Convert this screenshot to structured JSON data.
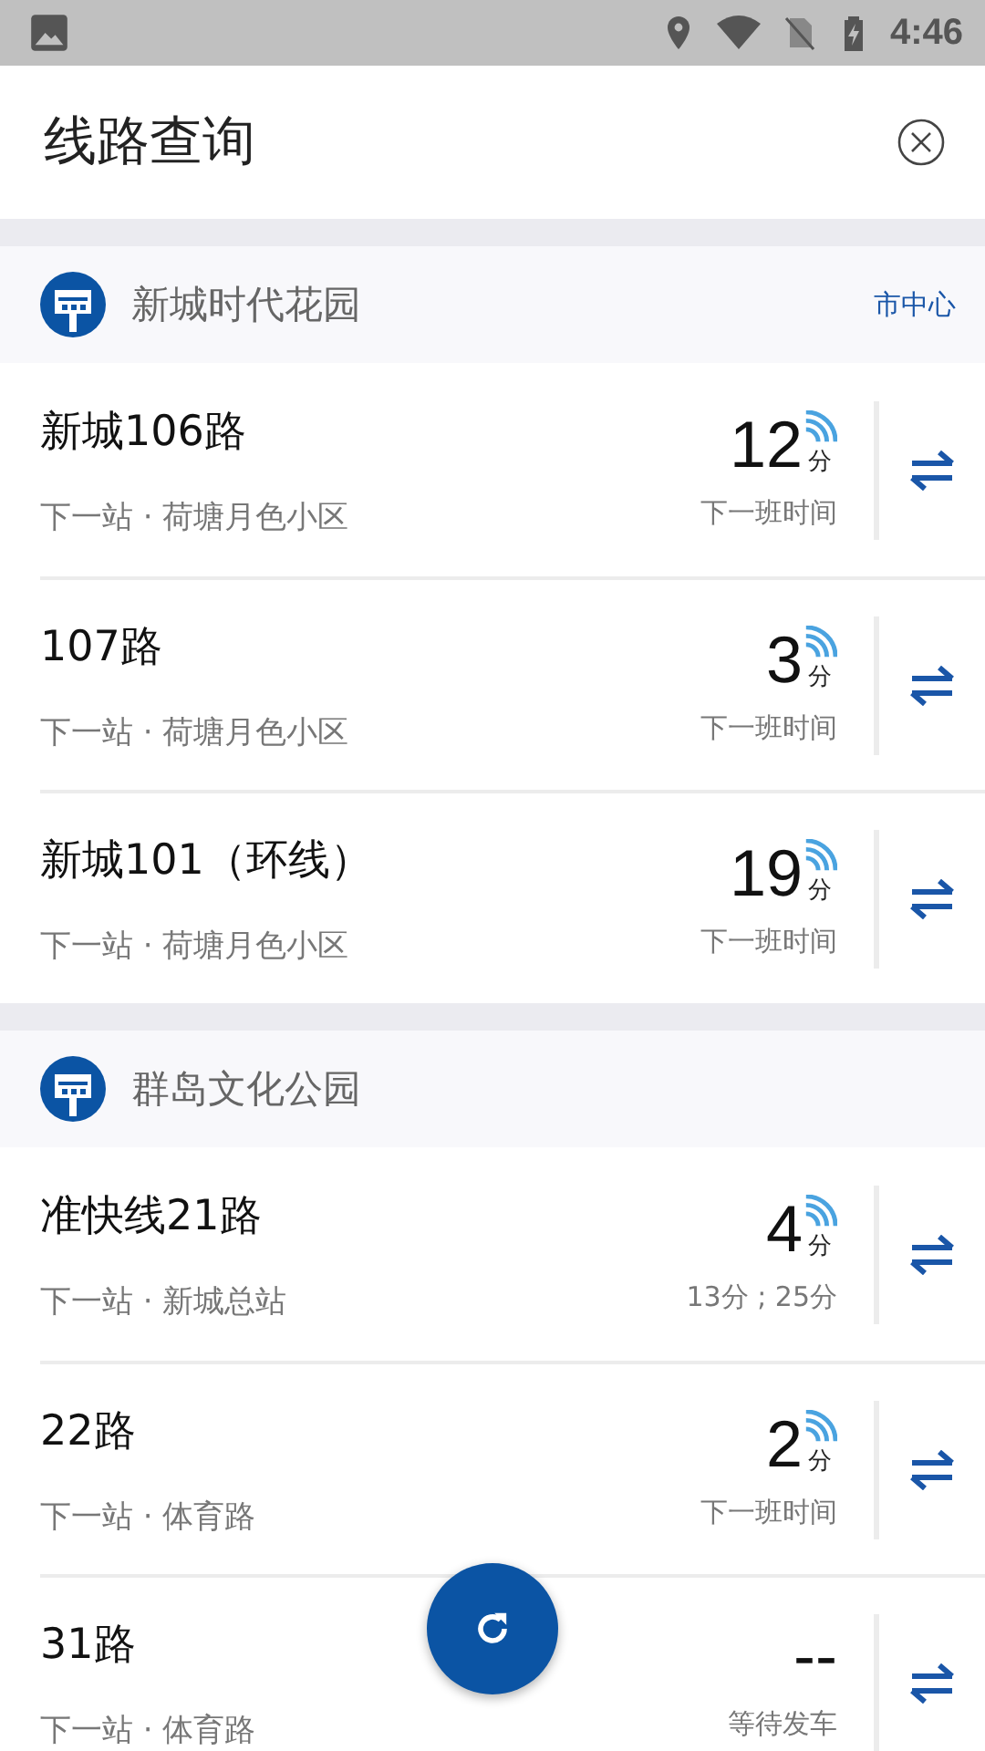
{
  "status_bar": {
    "time": "4:46"
  },
  "header": {
    "title": "线路查询"
  },
  "stops": [
    {
      "name": "新城时代花园",
      "direction": "市中心",
      "routes": [
        {
          "name": "新城106路",
          "next_stop": "下一站 · 荷塘月色小区",
          "minutes": "12",
          "unit": "分",
          "realtime": true,
          "note": "下一班时间"
        },
        {
          "name": "107路",
          "next_stop": "下一站 · 荷塘月色小区",
          "minutes": "3",
          "unit": "分",
          "realtime": true,
          "note": "下一班时间"
        },
        {
          "name": "新城101（环线）",
          "next_stop": "下一站 · 荷塘月色小区",
          "minutes": "19",
          "unit": "分",
          "realtime": true,
          "note": "下一班时间"
        }
      ]
    },
    {
      "name": "群岛文化公园",
      "routes": [
        {
          "name": "准快线21路",
          "next_stop": "下一站 · 新城总站",
          "minutes": "4",
          "unit": "分",
          "realtime": true,
          "note": "13分 ; 25分"
        },
        {
          "name": "22路",
          "next_stop": "下一站 · 体育路",
          "minutes": "2",
          "unit": "分",
          "realtime": true,
          "note": "下一班时间"
        },
        {
          "name": "31路",
          "next_stop": "下一站 · 体育路",
          "minutes": "--",
          "realtime": false,
          "note": "等待发车"
        }
      ]
    }
  ]
}
